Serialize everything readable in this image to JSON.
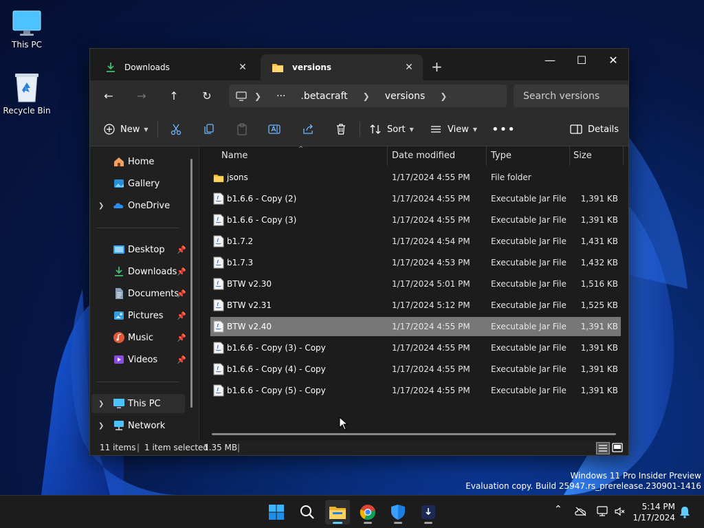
{
  "desktop": {
    "icons": [
      {
        "label": "This PC",
        "icon": "monitor-icon"
      },
      {
        "label": "Recycle Bin",
        "icon": "recycle-bin-icon"
      }
    ]
  },
  "window": {
    "tabs": [
      {
        "label": "Downloads",
        "icon": "download-icon",
        "active": false
      },
      {
        "label": "versions",
        "icon": "folder-icon",
        "active": true
      }
    ],
    "new_tab_icon": "+",
    "controls": {
      "minimize": "—",
      "maximize": "☐",
      "close": "✕"
    },
    "address": {
      "more": "···",
      "segments": [
        ".betacraft",
        "versions"
      ]
    },
    "search_placeholder": "Search versions",
    "toolbar": {
      "new_label": "New",
      "sort_label": "Sort",
      "view_label": "View",
      "details_label": "Details"
    },
    "sidebar": {
      "items": [
        {
          "label": "Home",
          "icon": "home-icon",
          "expandable": false,
          "pinned": false
        },
        {
          "label": "Gallery",
          "icon": "gallery-icon",
          "expandable": false,
          "pinned": false
        },
        {
          "label": "OneDrive",
          "icon": "cloud-icon",
          "expandable": true,
          "pinned": false
        },
        {
          "label": "Desktop",
          "icon": "desktop-icon",
          "expandable": false,
          "pinned": true
        },
        {
          "label": "Downloads",
          "icon": "download-icon",
          "expandable": false,
          "pinned": true
        },
        {
          "label": "Documents",
          "icon": "document-icon",
          "expandable": false,
          "pinned": true
        },
        {
          "label": "Pictures",
          "icon": "pictures-icon",
          "expandable": false,
          "pinned": true
        },
        {
          "label": "Music",
          "icon": "music-icon",
          "expandable": false,
          "pinned": true
        },
        {
          "label": "Videos",
          "icon": "videos-icon",
          "expandable": false,
          "pinned": true
        },
        {
          "label": "This PC",
          "icon": "monitor-icon",
          "expandable": true,
          "pinned": false,
          "selected": true
        },
        {
          "label": "Network",
          "icon": "network-icon",
          "expandable": true,
          "pinned": false
        }
      ]
    },
    "columns": {
      "name": "Name",
      "date": "Date modified",
      "type": "Type",
      "size": "Size"
    },
    "files": [
      {
        "name": "jsons",
        "date": "1/17/2024 4:55 PM",
        "type": "File folder",
        "size": "",
        "kind": "folder"
      },
      {
        "name": "b1.6.6 - Copy (2)",
        "date": "1/17/2024 4:55 PM",
        "type": "Executable Jar File",
        "size": "1,391 KB",
        "kind": "jar"
      },
      {
        "name": "b1.6.6 - Copy (3)",
        "date": "1/17/2024 4:55 PM",
        "type": "Executable Jar File",
        "size": "1,391 KB",
        "kind": "jar"
      },
      {
        "name": "b1.7.2",
        "date": "1/17/2024 4:54 PM",
        "type": "Executable Jar File",
        "size": "1,431 KB",
        "kind": "jar"
      },
      {
        "name": "b1.7.3",
        "date": "1/17/2024 4:53 PM",
        "type": "Executable Jar File",
        "size": "1,432 KB",
        "kind": "jar"
      },
      {
        "name": "BTW v2.30",
        "date": "1/17/2024 5:01 PM",
        "type": "Executable Jar File",
        "size": "1,516 KB",
        "kind": "jar"
      },
      {
        "name": "BTW v2.31",
        "date": "1/17/2024 5:12 PM",
        "type": "Executable Jar File",
        "size": "1,525 KB",
        "kind": "jar"
      },
      {
        "name": "BTW v2.40",
        "date": "1/17/2024 4:55 PM",
        "type": "Executable Jar File",
        "size": "1,391 KB",
        "kind": "jar",
        "selected": true
      },
      {
        "name": "b1.6.6 - Copy (3) - Copy",
        "date": "1/17/2024 4:55 PM",
        "type": "Executable Jar File",
        "size": "1,391 KB",
        "kind": "jar"
      },
      {
        "name": "b1.6.6 - Copy (4) - Copy",
        "date": "1/17/2024 4:55 PM",
        "type": "Executable Jar File",
        "size": "1,391 KB",
        "kind": "jar"
      },
      {
        "name": "b1.6.6 - Copy (5) - Copy",
        "date": "1/17/2024 4:55 PM",
        "type": "Executable Jar File",
        "size": "1,391 KB",
        "kind": "jar"
      }
    ],
    "status": {
      "count": "11 items",
      "selection": "1 item selected",
      "size": "1.35 MB"
    }
  },
  "watermark": {
    "line1": "Windows 11 Pro Insider Preview",
    "line2": "Evaluation copy. Build 25947.rs_prerelease.230901-1416"
  },
  "taskbar": {
    "time": "5:14 PM",
    "date": "1/17/2024"
  },
  "colors": {
    "accent": "#60cdff",
    "folder": "#f7c548",
    "selection": "#777777"
  }
}
